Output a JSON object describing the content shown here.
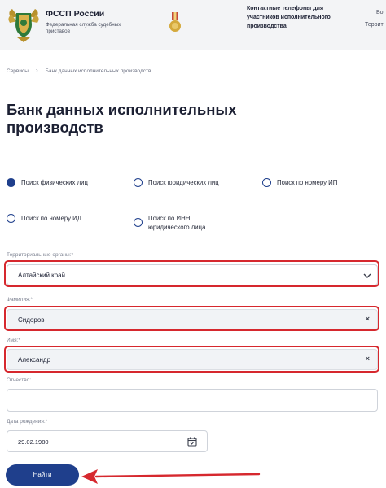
{
  "header": {
    "brand_title": "ФССП России",
    "brand_subtitle": "Федеральная служба судебных приставов",
    "contacts": "Контактные телефоны для участников исполнительного производства",
    "right_1": "Во",
    "right_2": "Террит"
  },
  "breadcrumb": {
    "services": "Сервисы",
    "separator": "›",
    "current": "Банк данных исполнительных производств"
  },
  "page_title": "Банк данных исполнительных производств",
  "search_types": [
    {
      "label": "Поиск физических лиц",
      "checked": true
    },
    {
      "label": "Поиск юридических лиц",
      "checked": false
    },
    {
      "label": "Поиск по номеру ИП",
      "checked": false
    },
    {
      "label": "Поиск по номеру ИД",
      "checked": false
    },
    {
      "label": "Поиск по ИНН юридического лица",
      "checked": false
    }
  ],
  "form": {
    "region_label": "Территориальные органы:*",
    "region_value": "Алтайский край",
    "lastname_label": "Фамилия:*",
    "lastname_value": "Сидоров",
    "firstname_label": "Имя:*",
    "firstname_value": "Александр",
    "patronymic_label": "Отчество:",
    "patronymic_value": "",
    "birthdate_label": "Дата рождения:*",
    "birthdate_value": "29.02.1980",
    "clear_glyph": "×",
    "submit_label": "Найти"
  },
  "colors": {
    "primary": "#1f3f8c",
    "highlight": "#d6282e",
    "header_bg": "#f3f4f6",
    "filled_field_bg": "#f1f3f6"
  }
}
